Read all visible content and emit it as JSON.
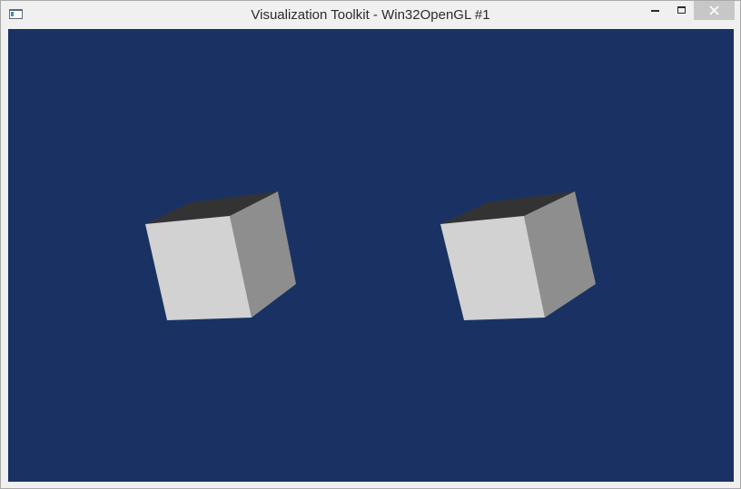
{
  "window": {
    "title": "Visualization Toolkit - Win32OpenGL #1",
    "icon": "app-window-icon",
    "controls": [
      "minimize-icon",
      "maximize-icon",
      "close-icon"
    ]
  },
  "viewport": {
    "background_color": "#1a3263",
    "objects": [
      {
        "type": "cube",
        "name": "left-cube",
        "front_color": "#d2d2d2",
        "side_color": "#8e8e8e",
        "top_color": "#333333"
      },
      {
        "type": "cube",
        "name": "right-cube",
        "front_color": "#d2d2d2",
        "side_color": "#8e8e8e",
        "top_color": "#333333"
      }
    ]
  }
}
